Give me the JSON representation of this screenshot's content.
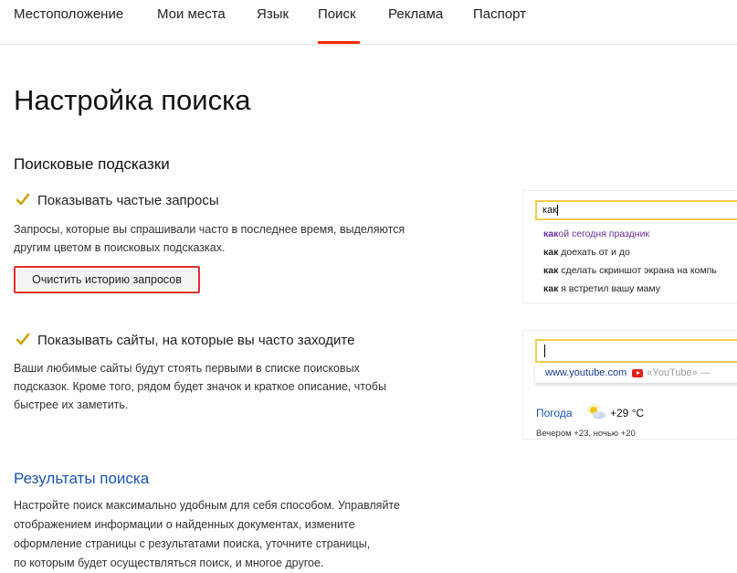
{
  "nav": {
    "items": [
      {
        "label": "Местоположение"
      },
      {
        "label": "Мои места"
      },
      {
        "label": "Язык"
      },
      {
        "label": "Поиск",
        "active": true
      },
      {
        "label": "Реклама"
      },
      {
        "label": "Паспорт"
      }
    ],
    "accent_color": "#ff2a00"
  },
  "page": {
    "title": "Настройка поиска"
  },
  "suggestions_section": {
    "title": "Поисковые подсказки",
    "frequent": {
      "label": "Показывать частые запросы",
      "checked": true,
      "description_line1": "Запросы, которые вы спрашивали часто в последнее время, выделяются",
      "description_line2": "другим цветом в поисковых подсказках.",
      "clear_button": "Очистить историю запросов",
      "highlight_color": "#e03030"
    },
    "sites": {
      "label": "Показывать сайты, на которые вы часто заходите",
      "checked": true,
      "description_line1": "Ваши любимые сайты будут стоять первыми в списке поисковых",
      "description_line2": "подсказок. Кроме того, рядом будет значок и краткое описание, чтобы",
      "description_line3": "быстрее их заметить."
    }
  },
  "preview_queries": {
    "input_value": "как",
    "suggestions": [
      {
        "bold": "как",
        "rest": "ой сегодня праздник",
        "visited": true
      },
      {
        "bold": "как",
        "rest": " доехать от и до",
        "visited": false
      },
      {
        "bold": "как",
        "rest": " сделать скриншот экрана на компь",
        "visited": false
      },
      {
        "bold": "как",
        "rest": " я встретил вашу маму",
        "visited": false
      }
    ]
  },
  "preview_sites": {
    "site_url": "www.youtube.com",
    "site_desc": "«YouTube» —",
    "weather_label": "Погода",
    "weather_temp": "+29 °С",
    "weather_sub": "Вечером +23,   ночью +20",
    "icon": "sun-cloud-icon"
  },
  "results_section": {
    "title": "Результаты поиска",
    "line1": "Настройте поиск максимально удобным для себя способом. Управляйте",
    "line2": "отображением информации о найденных документах, измените",
    "line3": "оформление страницы с результатами поиска, уточните страницы,",
    "line4": "по которым будет осуществляться поиск, и многое другое."
  },
  "colors": {
    "checkmark": "#c9a400",
    "input_border": "#f3cd4c",
    "link": "#1a55b5",
    "visited": "#6b2ca0"
  }
}
